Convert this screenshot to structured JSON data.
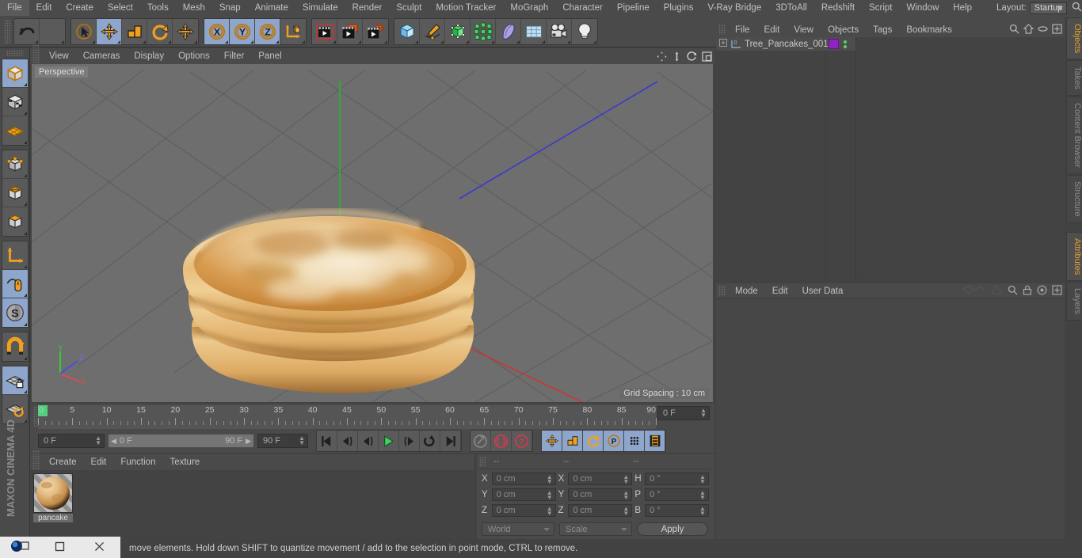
{
  "app": {
    "title": "Cinema 4D",
    "brand": "MAXON CINEMA 4D"
  },
  "menubar": {
    "items": [
      "File",
      "Edit",
      "Create",
      "Select",
      "Tools",
      "Mesh",
      "Snap",
      "Animate",
      "Simulate",
      "Render",
      "Sculpt",
      "Motion Tracker",
      "MoGraph",
      "Character",
      "Pipeline",
      "Plugins",
      "V-Ray Bridge",
      "3DToAll",
      "Redshift",
      "Script",
      "Window",
      "Help"
    ],
    "layout_label": "Layout:",
    "layout_value": "Startup",
    "search_icon": "search-icon"
  },
  "toolbar": {
    "groups": [
      {
        "name": "history",
        "buttons": [
          {
            "icon": "undo-icon",
            "label": "Undo",
            "selected": false
          },
          {
            "icon": "redo-icon",
            "label": "Redo",
            "selected": false
          }
        ]
      },
      {
        "name": "tools",
        "buttons": [
          {
            "icon": "live-selection-icon",
            "label": "Live Selection",
            "selected": false
          },
          {
            "icon": "move-icon",
            "label": "Move",
            "selected": true
          },
          {
            "icon": "scale-icon",
            "label": "Scale",
            "selected": false
          },
          {
            "icon": "rotate-icon",
            "label": "Rotate",
            "selected": false
          },
          {
            "icon": "move-alt-icon",
            "label": "Move",
            "selected": false
          }
        ]
      },
      {
        "name": "axis-locks",
        "buttons": [
          {
            "icon": "axis-x-icon",
            "label": "X",
            "selected": true
          },
          {
            "icon": "axis-y-icon",
            "label": "Y",
            "selected": true
          },
          {
            "icon": "axis-z-icon",
            "label": "Z",
            "selected": true
          },
          {
            "icon": "world-coordinates-icon",
            "label": "World / Object Coordinate System",
            "selected": false
          }
        ]
      },
      {
        "name": "render",
        "buttons": [
          {
            "icon": "render-view-icon",
            "label": "Render View",
            "selected": false
          },
          {
            "icon": "render-region-icon",
            "label": "Render to Picture Viewer",
            "selected": false
          },
          {
            "icon": "render-settings-icon",
            "label": "Edit Render Settings",
            "selected": false
          }
        ]
      },
      {
        "name": "create",
        "buttons": [
          {
            "icon": "cube-primitive-icon",
            "label": "Add Cube Object",
            "selected": false
          },
          {
            "icon": "spline-pen-icon",
            "label": "Add Spline Object",
            "selected": false
          },
          {
            "icon": "nurbs-icon",
            "label": "Add Generator Object",
            "selected": false
          },
          {
            "icon": "array-icon",
            "label": "Add Modelling Object",
            "selected": false
          },
          {
            "icon": "deformer-icon",
            "label": "Add Deformer Object",
            "selected": false
          },
          {
            "icon": "environment-icon",
            "label": "Add Scene Object",
            "selected": false
          },
          {
            "icon": "camera-icon",
            "label": "Add Camera Object",
            "selected": false
          },
          {
            "icon": "light-icon",
            "label": "Add Light Object",
            "selected": false
          }
        ]
      }
    ]
  },
  "left_toolbar": {
    "groups": [
      {
        "buttons": [
          {
            "icon": "model-mode-icon",
            "label": "Model Mode",
            "selected": true
          },
          {
            "icon": "texture-mode-icon",
            "label": "Texture Mode",
            "selected": false
          },
          {
            "icon": "workplane-mode-icon",
            "label": "Workplane Mode",
            "selected": false
          }
        ]
      },
      {
        "buttons": [
          {
            "icon": "points-mode-icon",
            "label": "Points Mode",
            "selected": false
          },
          {
            "icon": "edges-mode-icon",
            "label": "Edges Mode",
            "selected": false
          },
          {
            "icon": "polygons-mode-icon",
            "label": "Polygons Mode",
            "selected": false
          }
        ]
      },
      {
        "buttons": [
          {
            "icon": "object-axis-icon",
            "label": "Enable Axis Modification",
            "selected": false
          },
          {
            "icon": "viewport-solo-icon",
            "label": "Enable Viewport Solo",
            "selected": true
          },
          {
            "icon": "snap-s-icon",
            "label": "Enable Snapping",
            "selected": true
          }
        ]
      },
      {
        "buttons": [
          {
            "icon": "magnet-icon",
            "label": "Magnet",
            "selected": false
          }
        ]
      },
      {
        "buttons": [
          {
            "icon": "workplane-lock-icon",
            "label": "Lock Workplane",
            "selected": true
          },
          {
            "icon": "workplane-rotate-icon",
            "label": "Planar Workplane Rotation",
            "selected": false
          }
        ]
      }
    ]
  },
  "viewport": {
    "menu": [
      "View",
      "Cameras",
      "Display",
      "Options",
      "Filter",
      "Panel"
    ],
    "right_icons": [
      "pan-icon",
      "dolly-icon",
      "orbit-icon",
      "maximize-icon"
    ],
    "label": "Perspective",
    "grid_spacing": "Grid Spacing : 10 cm",
    "axis_labels": {
      "x": "X",
      "y": "Y",
      "z": "Z"
    },
    "scene_object": "pancake stack"
  },
  "timeline": {
    "ticks": [
      "0",
      "5",
      "10",
      "15",
      "20",
      "25",
      "30",
      "35",
      "40",
      "45",
      "50",
      "55",
      "60",
      "65",
      "70",
      "75",
      "80",
      "85",
      "90"
    ],
    "current_frame_field": "0 F",
    "range_start": "0 F",
    "range_end": "90 F",
    "max_frame_field": "90 F",
    "right_frame_field": "0 F",
    "transport": [
      {
        "icon": "go-to-start-icon",
        "label": "Go to Start Frame",
        "selected": false
      },
      {
        "icon": "play-backwards-icon",
        "label": "Play Backwards",
        "selected": false
      },
      {
        "icon": "previous-frame-icon",
        "label": "Go to Previous Frame",
        "selected": false
      },
      {
        "icon": "play-forwards-icon",
        "label": "Play Forwards",
        "selected": false
      },
      {
        "icon": "next-frame-icon",
        "label": "Go to Next Frame",
        "selected": false
      },
      {
        "icon": "play-mode-loop-icon",
        "label": "Playback Mode",
        "selected": false
      },
      {
        "icon": "go-to-end-icon",
        "label": "Go to End Frame",
        "selected": false
      }
    ],
    "key_tools": [
      {
        "icon": "autokey-wrench-icon",
        "label": "Record Active Objects",
        "selected": false
      },
      {
        "icon": "autokeying-icon",
        "label": "Autokeying",
        "selected": false
      },
      {
        "icon": "keyframe-help-icon",
        "label": "Keyframe Selection",
        "selected": false
      }
    ],
    "key_toggles": [
      {
        "icon": "key-position-icon",
        "label": "Position",
        "selected": true
      },
      {
        "icon": "key-scale-icon",
        "label": "Scale",
        "selected": true
      },
      {
        "icon": "key-rotation-icon",
        "label": "Rotation",
        "selected": true
      },
      {
        "icon": "key-param-icon",
        "label": "Parameter",
        "selected": true
      },
      {
        "icon": "key-pla-icon",
        "label": "Point Level Animation",
        "selected": true
      },
      {
        "icon": "timeline-toggle-icon",
        "label": "Timeline",
        "selected": true
      }
    ]
  },
  "material_manager": {
    "menu": [
      "Create",
      "Edit",
      "Function",
      "Texture"
    ],
    "materials": [
      {
        "name": "pancake",
        "color": "#e0b274"
      }
    ]
  },
  "coordinates": {
    "headers": [
      "--",
      "--",
      "--"
    ],
    "rows": [
      {
        "pos_label": "X",
        "pos_value": "0 cm",
        "size_label": "X",
        "size_value": "0 cm",
        "rot_label": "H",
        "rot_value": "0 °"
      },
      {
        "pos_label": "Y",
        "pos_value": "0 cm",
        "size_label": "Y",
        "size_value": "0 cm",
        "rot_label": "P",
        "rot_value": "0 °"
      },
      {
        "pos_label": "Z",
        "pos_value": "0 cm",
        "size_label": "Z",
        "size_value": "0 cm",
        "rot_label": "B",
        "rot_value": "0 °"
      }
    ],
    "system_dropdown": "World",
    "mode_dropdown": "Scale",
    "apply_label": "Apply"
  },
  "object_manager": {
    "menu": [
      "File",
      "Edit",
      "View",
      "Objects",
      "Tags",
      "Bookmarks"
    ],
    "icons": [
      "search-icon",
      "home-icon",
      "ellipse-icon",
      "expand-icon"
    ],
    "objects": [
      {
        "name": "Tree_Pancakes_001",
        "layer_badge": "0",
        "tag_color": "#8f24c3",
        "visibility_dots": "··"
      }
    ]
  },
  "attributes": {
    "menu": [
      "Mode",
      "Edit",
      "User Data"
    ],
    "icons": [
      "animation-icon",
      "cone-icon",
      "search-icon",
      "lock-icon",
      "target-icon",
      "expand-icon"
    ],
    "content": ""
  },
  "right_tabs": {
    "upper": [
      {
        "label": "Objects",
        "active": true
      },
      {
        "label": "Takes",
        "active": false
      },
      {
        "label": "Content Browser",
        "active": false
      },
      {
        "label": "Structure",
        "active": false
      }
    ],
    "lower": [
      {
        "label": "Attributes",
        "active": true
      },
      {
        "label": "Layers",
        "active": false
      }
    ]
  },
  "statusbar": {
    "text": "Move elements. Hold down SHIFT to quantize movement / add to the selection in point mode, CTRL to remove.",
    "visible_text": "move elements. Hold down SHIFT to quantize movement / add to the selection in point mode, CTRL to remove."
  },
  "window_controls": {
    "app_icon": "c4d-app-icon",
    "restore": "restore-icon",
    "maximize": "maximize-icon",
    "close": "close-icon"
  },
  "colors": {
    "accent_orange": "#e3a02c",
    "selection_blue": "#8ea6cc",
    "panel_bg": "#4a4a4a",
    "viewport_bg": "#6e6e6e",
    "axis_x": "#cc3535",
    "axis_y": "#35aa35",
    "axis_z": "#3a3ad0"
  }
}
